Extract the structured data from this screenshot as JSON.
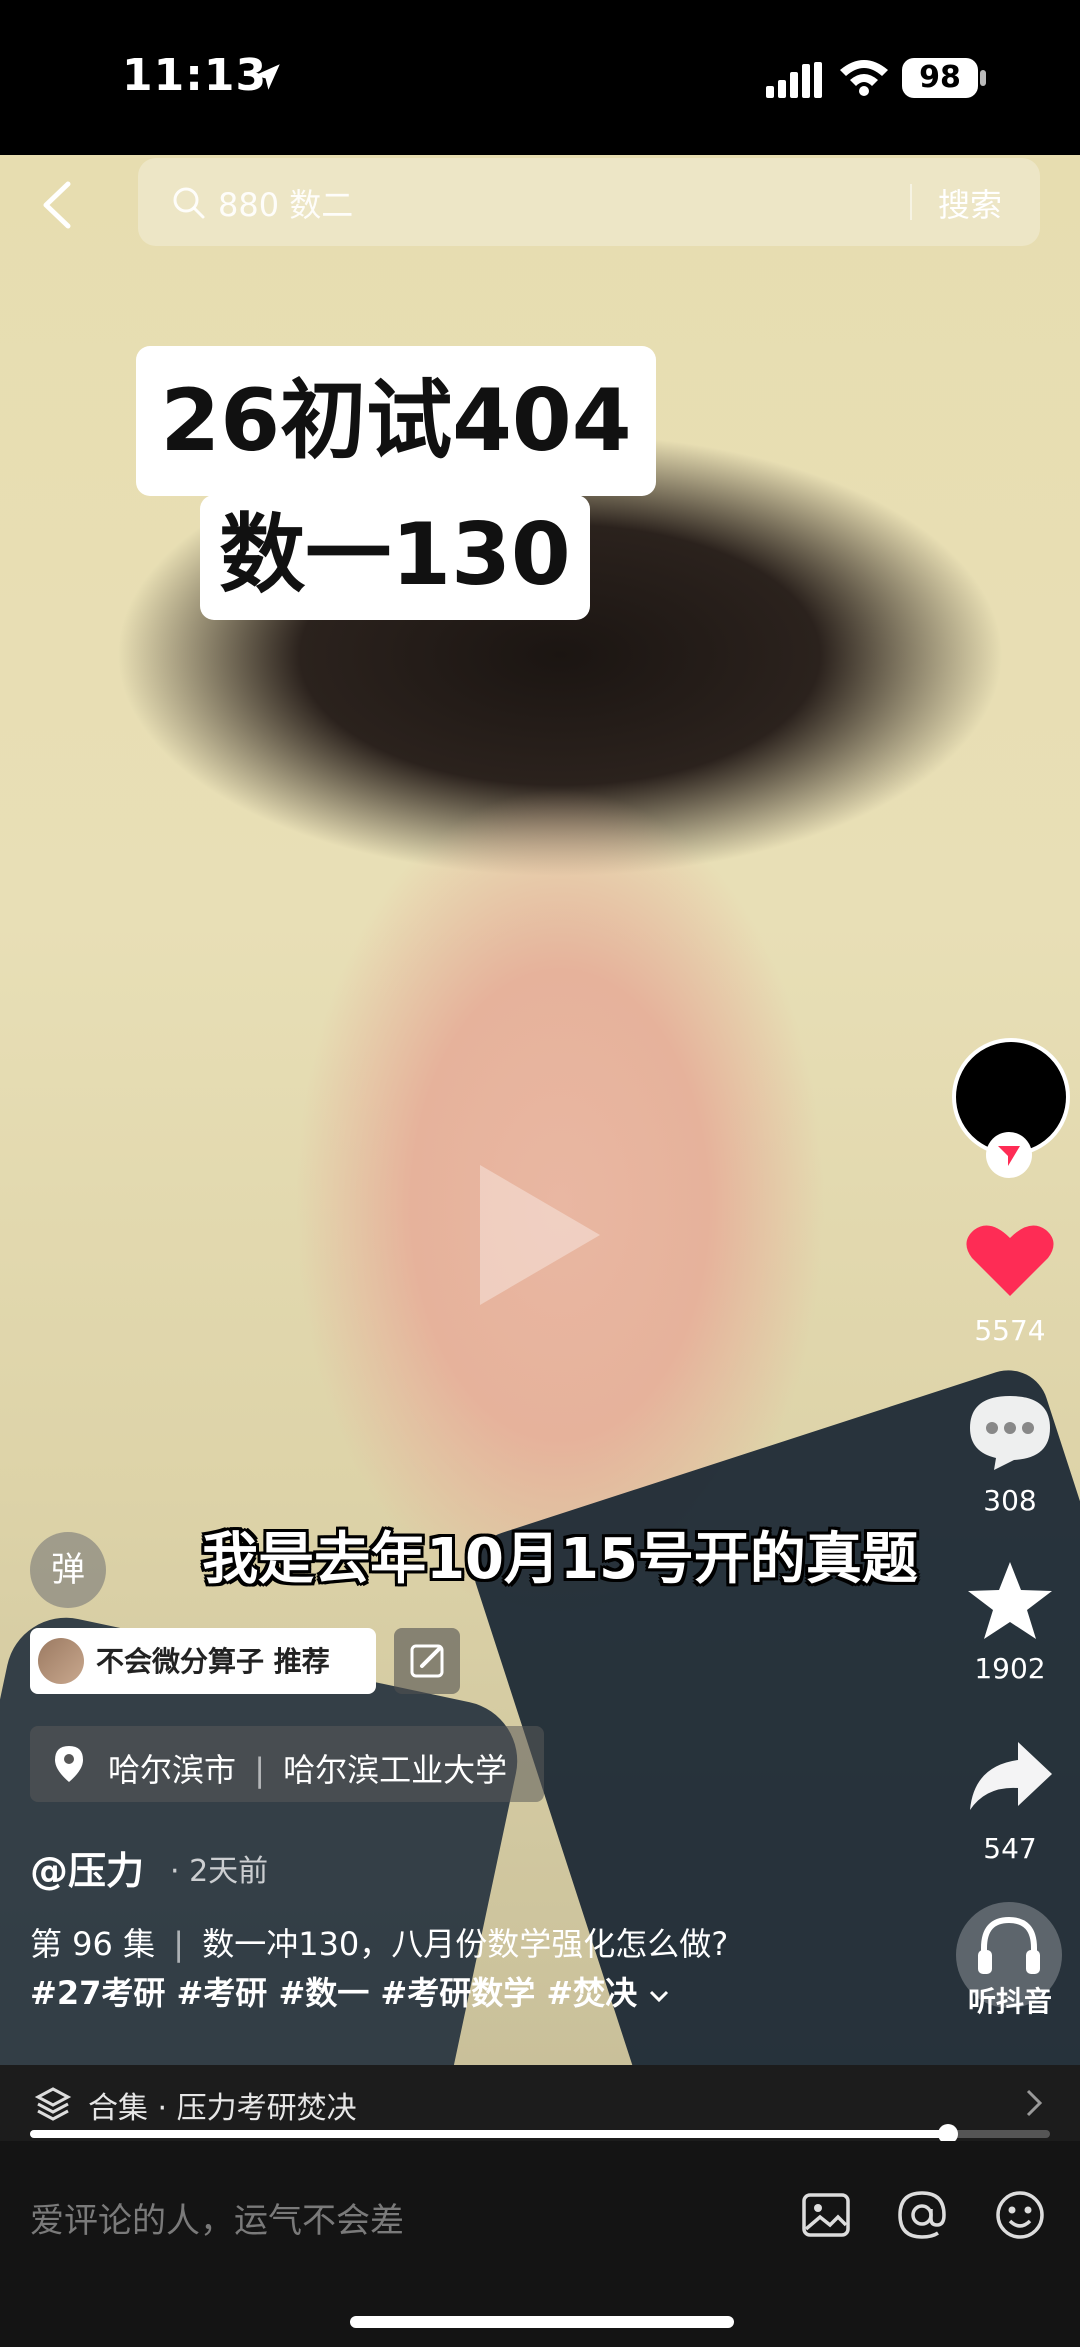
{
  "status_bar": {
    "time": "11:13",
    "battery": "98"
  },
  "search": {
    "query": "880 数二",
    "button": "搜索"
  },
  "video": {
    "overlay_caption_line1": "26初试404",
    "overlay_caption_line2": "数一130",
    "subtitle": "我是去年10月15号开的真题"
  },
  "rail": {
    "likes": "5574",
    "comments": "308",
    "favorites": "1902",
    "shares": "547",
    "listen_label": "听抖音",
    "like_color": "#fe2c55"
  },
  "danmu_label": "弹",
  "recommend_tag": "不会微分算子 推荐",
  "location": {
    "city": "哈尔滨市",
    "place": "哈尔滨工业大学"
  },
  "post": {
    "author": "@压力",
    "time_ago": "· 2天前",
    "episode": "第 96 集",
    "title": "数一冲130，八月份数学强化怎么做?",
    "tags": "#27考研 #考研 #数一 #考研数学 #焚决"
  },
  "collection": {
    "label": "合集 · 压力考研焚决",
    "progress": 0.9
  },
  "comment": {
    "placeholder": "爱评论的人，运气不会差"
  }
}
